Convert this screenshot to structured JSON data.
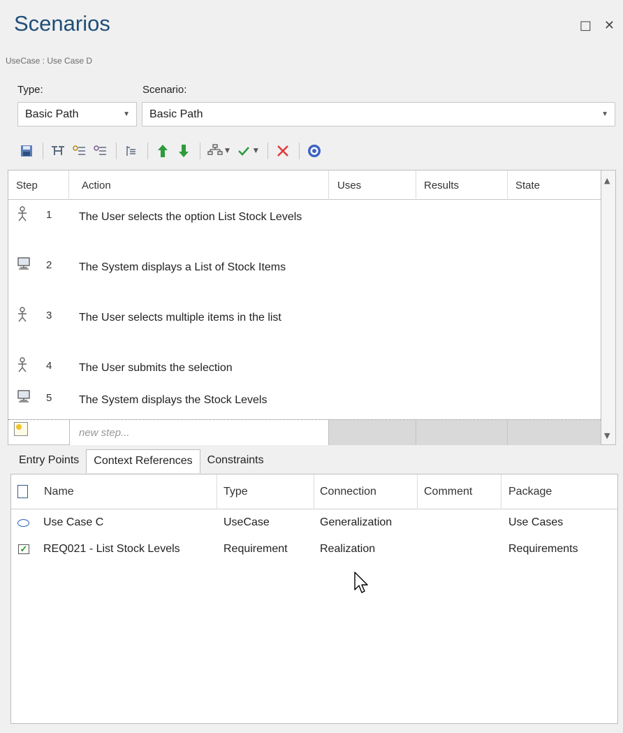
{
  "window": {
    "title": "Scenarios",
    "breadcrumb": "UseCase : Use Case D"
  },
  "form": {
    "type_label": "Type:",
    "type_value": "Basic Path",
    "scenario_label": "Scenario:",
    "scenario_value": "Basic Path"
  },
  "toolbar_icons": [
    "save-icon",
    "structure-icon",
    "actor-icon",
    "system-icon",
    "indent-icon",
    "move-up-icon",
    "move-down-icon",
    "generate-icon",
    "check-icon",
    "delete-icon",
    "help-icon"
  ],
  "steps_grid": {
    "columns": [
      "Step",
      "Action",
      "Uses",
      "Results",
      "State"
    ],
    "rows": [
      {
        "num": "1",
        "actor": "user",
        "action": "The User selects the option List Stock Levels"
      },
      {
        "num": "2",
        "actor": "system",
        "action": "The System displays a List of Stock Items"
      },
      {
        "num": "3",
        "actor": "user",
        "action": "The User selects multiple items in the list"
      },
      {
        "num": "4",
        "actor": "user",
        "action": "The User submits the selection"
      },
      {
        "num": "5",
        "actor": "system",
        "action": "The System displays the Stock Levels"
      }
    ],
    "new_step_placeholder": "new step..."
  },
  "tabs": [
    {
      "label": "Entry Points",
      "active": false
    },
    {
      "label": "Context References",
      "active": true
    },
    {
      "label": "Constraints",
      "active": false
    }
  ],
  "references_grid": {
    "columns": [
      "Name",
      "Type",
      "Connection",
      "Comment",
      "Package"
    ],
    "rows": [
      {
        "name": "Use Case C",
        "type": "UseCase",
        "connection": "Generalization",
        "comment": "",
        "package": "Use Cases",
        "icon": "usecase-icon"
      },
      {
        "name": "REQ021 - List Stock Levels",
        "type": "Requirement",
        "connection": "Realization",
        "comment": "",
        "package": "Requirements",
        "icon": "requirement-icon"
      }
    ]
  },
  "colors": {
    "title": "#1f4e79",
    "move_arrows": "#2e9b3a",
    "delete": "#e03a3a",
    "help": "#3f62c4"
  }
}
